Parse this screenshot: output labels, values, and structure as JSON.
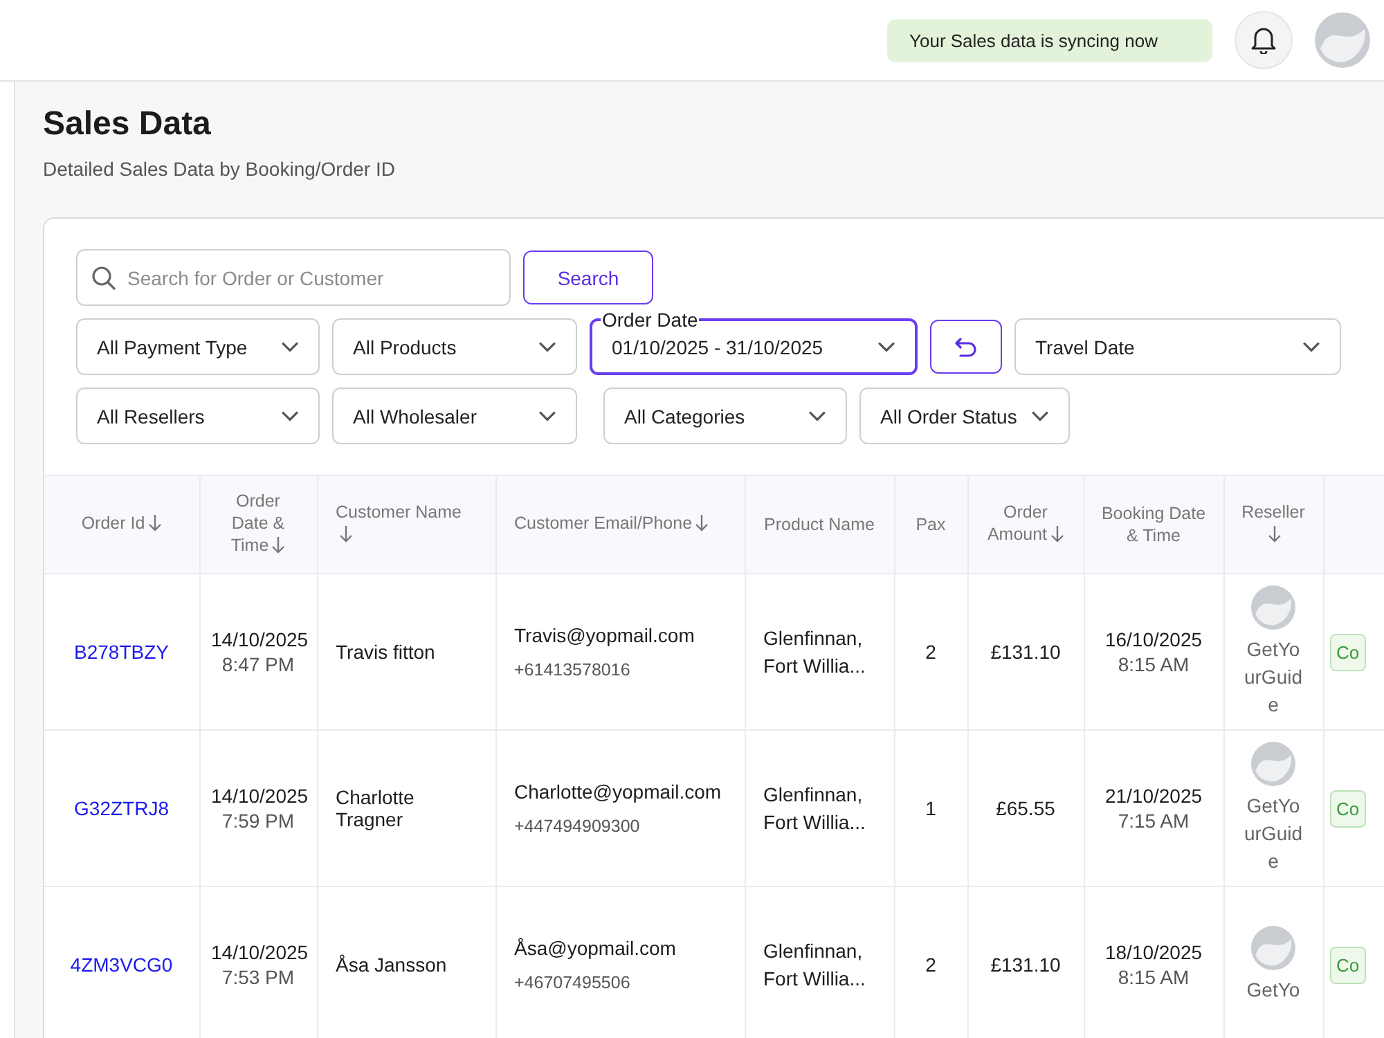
{
  "top_bar": {
    "sync_notice": "Your Sales data is syncing now"
  },
  "page": {
    "title": "Sales Data",
    "subtitle": "Detailed Sales Data by Booking/Order ID"
  },
  "search": {
    "placeholder": "Search for Order or Customer",
    "button": "Search"
  },
  "filter_rows": [
    [
      {
        "kind": "select",
        "value": "All Payment Type",
        "focused": false
      },
      {
        "kind": "select",
        "value": "All Products",
        "focused": false
      },
      {
        "kind": "date_range",
        "label": "Order Date",
        "value": "01/10/2025 - 31/10/2025",
        "focused": true
      },
      {
        "kind": "reset"
      },
      {
        "kind": "select",
        "value": "Travel Date",
        "focused": false
      }
    ],
    [
      {
        "kind": "select",
        "value": "All Resellers",
        "focused": false
      },
      {
        "kind": "select",
        "value": "All Wholesaler",
        "focused": false
      },
      {
        "kind": "select",
        "value": "All Categories",
        "focused": false
      },
      {
        "kind": "select",
        "value": "All Order Status",
        "focused": false
      }
    ]
  ],
  "table": {
    "columns": [
      {
        "label": "Order Id",
        "sortable": true
      },
      {
        "label": "Order Date & Time",
        "sortable": true
      },
      {
        "label": "Customer Name",
        "sortable": true
      },
      {
        "label": "Customer Email/Phone",
        "sortable": true
      },
      {
        "label": "Product Name",
        "sortable": false
      },
      {
        "label": "Pax",
        "sortable": false
      },
      {
        "label": "Order Amount",
        "sortable": true
      },
      {
        "label": "Booking Date & Time",
        "sortable": false
      },
      {
        "label": "Reseller",
        "sortable": true
      }
    ],
    "rows": [
      {
        "order_id": "B278TBZY",
        "order_date": "14/10/2025",
        "order_time": "8:47 PM",
        "customer_name": "Travis fitton",
        "email": "Travis@yopmail.com",
        "phone": "+61413578016",
        "product": "Glenfinnan, Fort Willia...",
        "pax": "2",
        "amount": "£131.10",
        "booking_date": "16/10/2025",
        "booking_time": "8:15 AM",
        "reseller": "GetYourGuide",
        "status": "Co"
      },
      {
        "order_id": "G32ZTRJ8",
        "order_date": "14/10/2025",
        "order_time": "7:59 PM",
        "customer_name": "Charlotte Tragner",
        "email": "Charlotte@yopmail.com",
        "phone": "+447494909300",
        "product": "Glenfinnan, Fort Willia...",
        "pax": "1",
        "amount": "£65.55",
        "booking_date": "21/10/2025",
        "booking_time": "7:15 AM",
        "reseller": "GetYourGuide",
        "status": "Co"
      },
      {
        "order_id": "4ZM3VCG0",
        "order_date": "14/10/2025",
        "order_time": "7:53 PM",
        "customer_name": "Åsa Jansson",
        "email": "Åsa@yopmail.com",
        "phone": "+46707495506",
        "product": "Glenfinnan, Fort Willia...",
        "pax": "2",
        "amount": "£131.10",
        "booking_date": "18/10/2025",
        "booking_time": "8:15 AM",
        "reseller": "GetYo",
        "status": "Co"
      }
    ]
  }
}
